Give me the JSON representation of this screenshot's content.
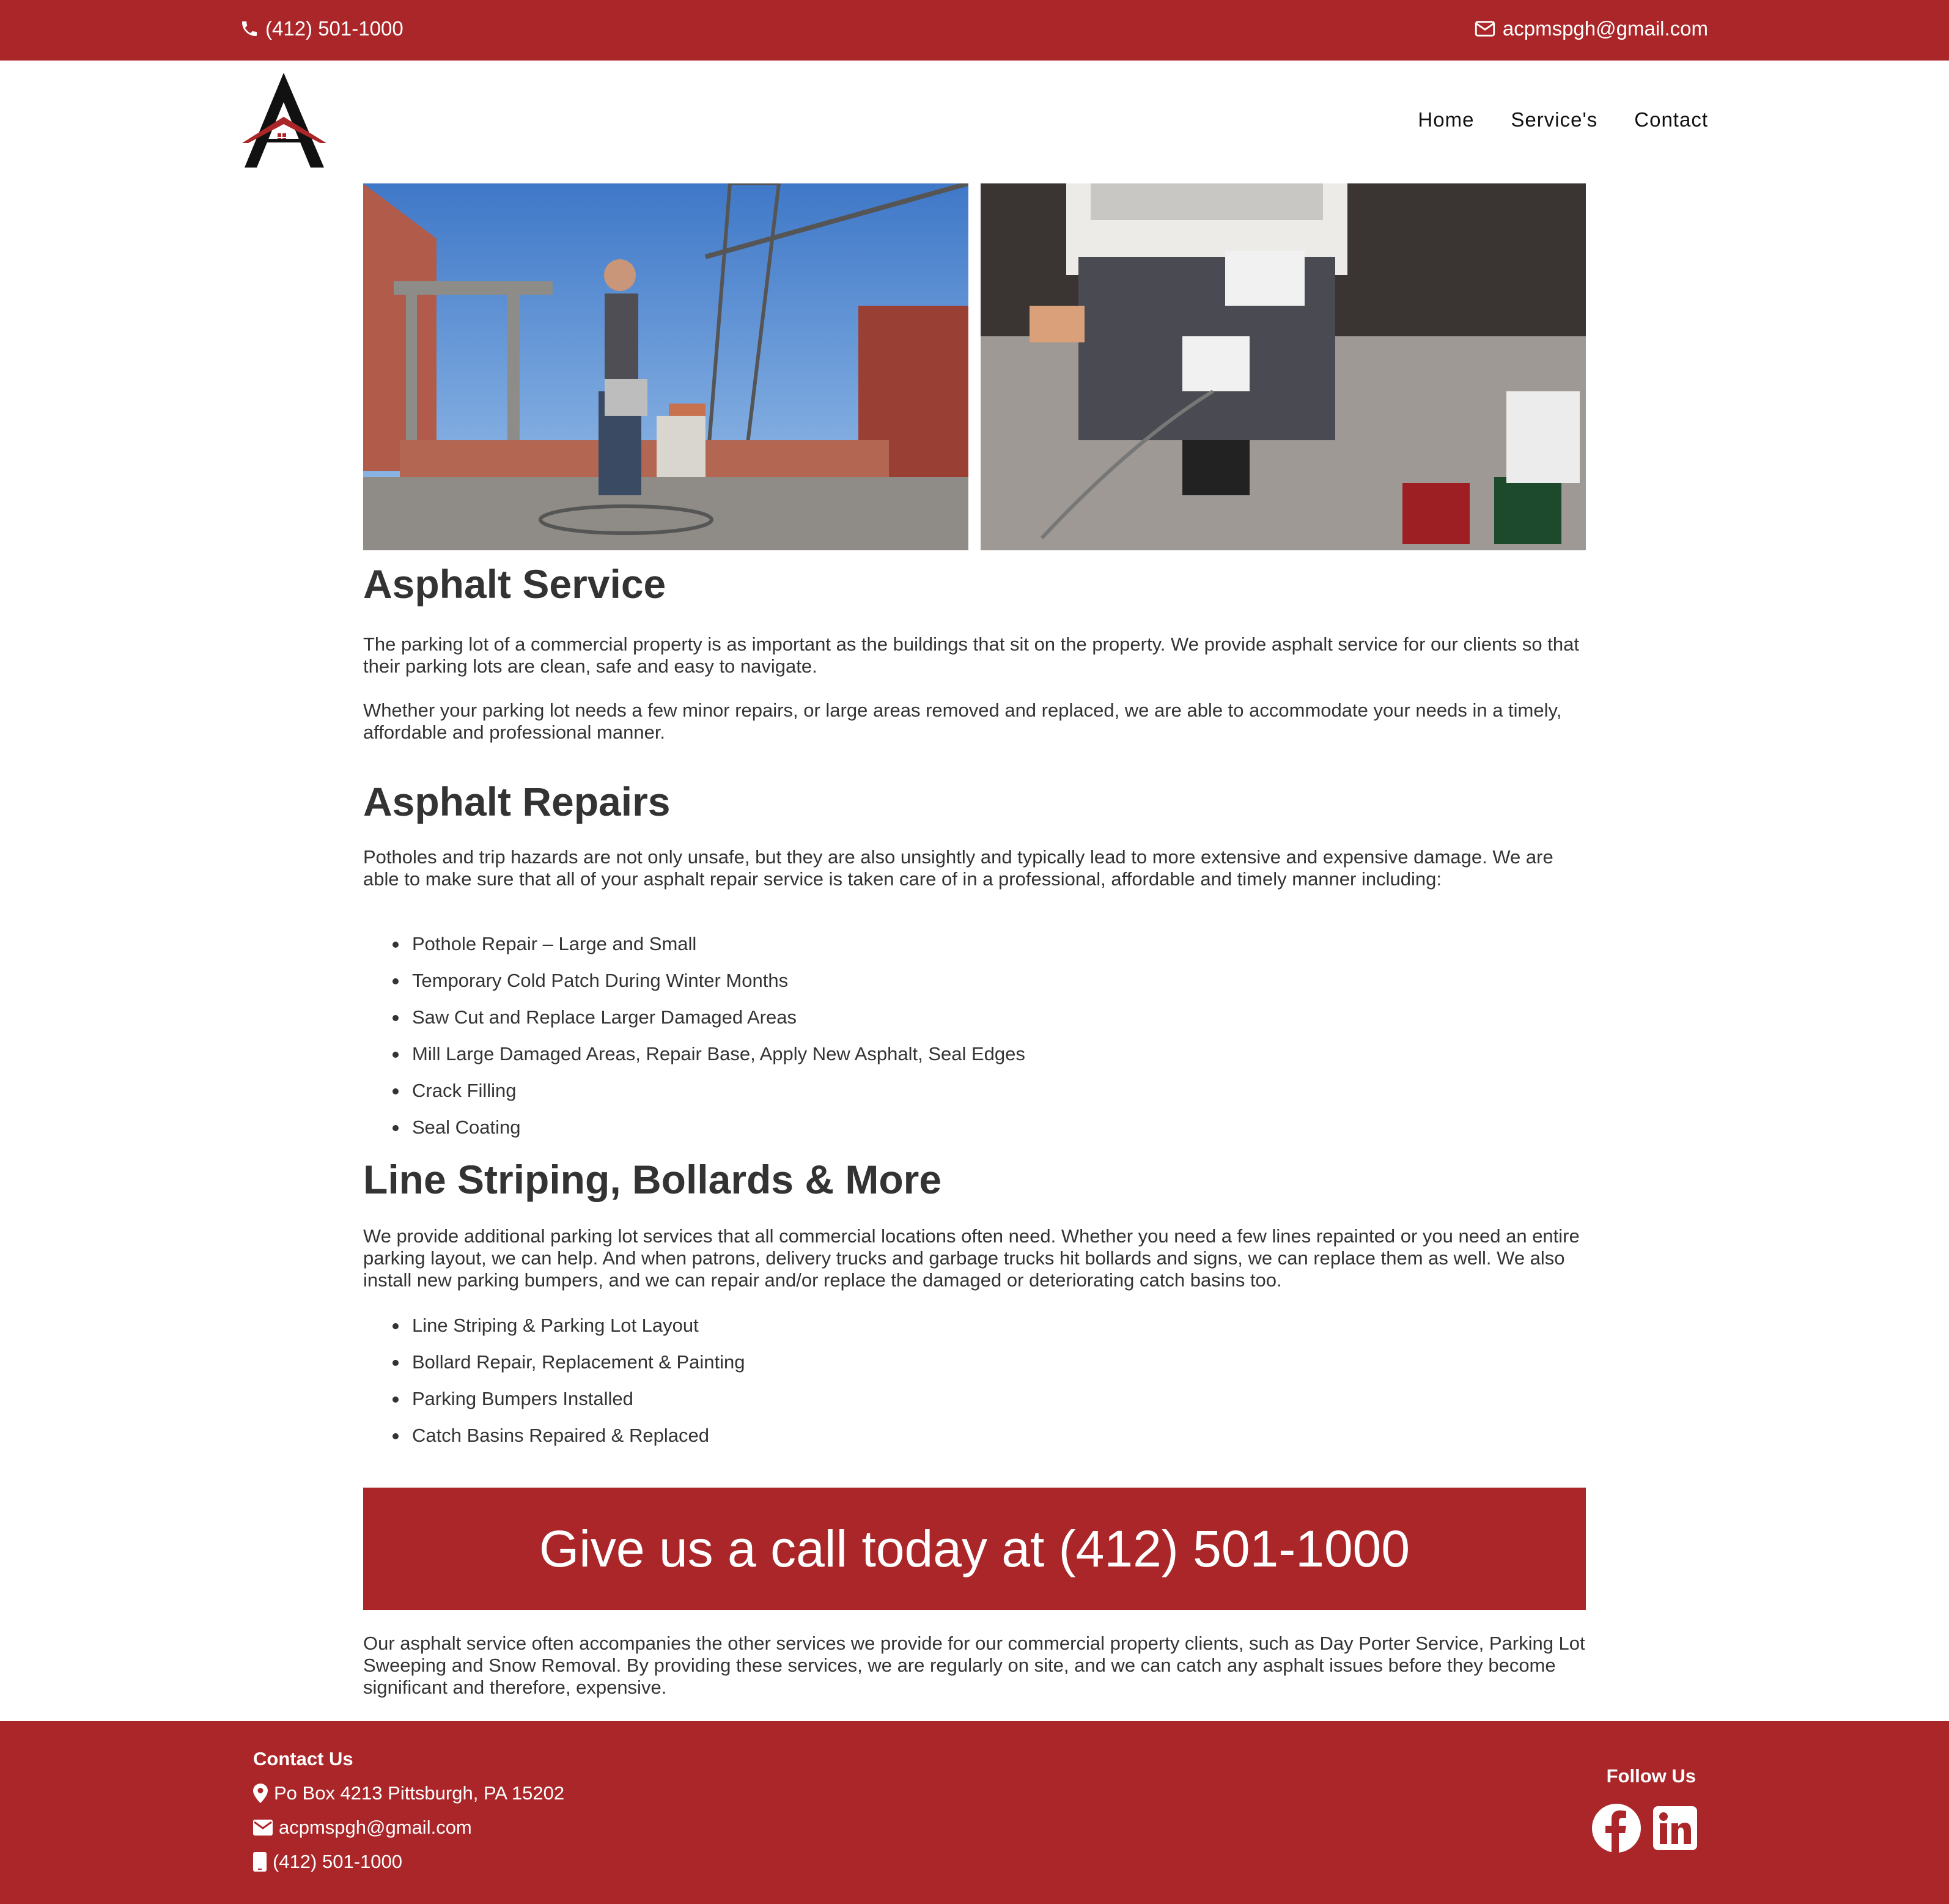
{
  "topbar": {
    "phone": "(412) 501-1000",
    "email": "acpmspgh@gmail.com"
  },
  "nav": {
    "items": [
      "Home",
      "Service's",
      "Contact"
    ]
  },
  "sections": {
    "asphalt_service": {
      "title": "Asphalt Service",
      "p1": "The parking lot of a commercial property is as important as the buildings that sit on the property. We provide asphalt service for our clients so that their parking lots are clean, safe and easy to navigate.",
      "p2": "Whether your parking lot needs a few minor repairs, or large areas removed and replaced, we are able to accommodate your needs in a timely, affordable and professional manner."
    },
    "asphalt_repairs": {
      "title": "Asphalt Repairs",
      "p1": "Potholes and trip hazards are not only unsafe, but they are also unsightly and typically lead to more extensive and expensive damage. We are able to make sure that all of your asphalt repair service is taken care of in a professional, affordable and timely manner including:",
      "items": [
        "Pothole Repair – Large and Small",
        "Temporary Cold Patch During Winter Months",
        "Saw Cut and Replace Larger Damaged Areas",
        "Mill Large Damaged Areas, Repair Base, Apply New Asphalt, Seal Edges",
        "Crack Filling",
        "Seal Coating"
      ]
    },
    "line_striping": {
      "title": "Line Striping, Bollards & More",
      "p1": "We provide additional parking lot services that all commercial locations often need. Whether you need a few lines repainted or you need an entire parking layout, we can help. And when patrons, delivery trucks and garbage trucks hit bollards and signs, we can replace them as well. We also install new parking bumpers, and we can repair and/or replace the damaged or deteriorating catch basins too.",
      "items": [
        "Line Striping & Parking Lot Layout",
        "Bollard Repair, Replacement & Painting",
        "Parking Bumpers Installed",
        "Catch Basins Repaired & Replaced"
      ]
    }
  },
  "cta": {
    "text": "Give us a call today at (412) 501-1000"
  },
  "closing": {
    "text": "Our asphalt service often accompanies the other services we provide for our commercial property clients, such as Day Porter Service, Parking Lot Sweeping and Snow Removal. By providing these services, we are regularly on site, and we can catch any asphalt issues before they become significant and therefore, expensive."
  },
  "footer": {
    "contact_heading": "Contact Us",
    "address": "Po Box 4213 Pittsburgh, PA 15202",
    "email": "acpmspgh@gmail.com",
    "phone": "(412) 501-1000",
    "follow_heading": "Follow Us",
    "social": [
      "facebook-icon",
      "linkedin-icon"
    ]
  },
  "colors": {
    "brand_red": "#aa2629",
    "text": "#333333"
  }
}
